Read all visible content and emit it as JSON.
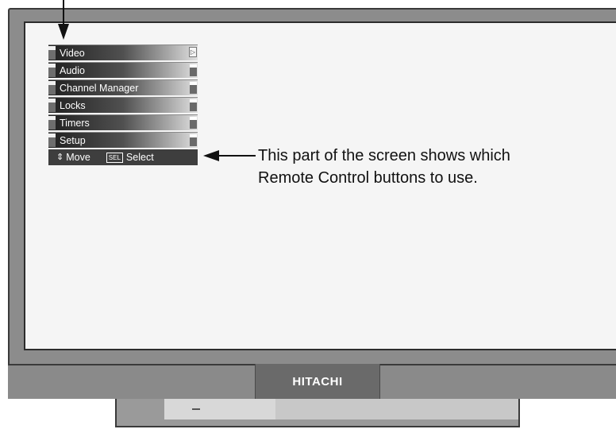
{
  "menu": {
    "items": [
      {
        "label": "Video",
        "icon": "right-arrow-icon"
      },
      {
        "label": "Audio",
        "icon": "menu-tab-icon"
      },
      {
        "label": "Channel Manager",
        "icon": "menu-tab-icon"
      },
      {
        "label": "Locks",
        "icon": "menu-tab-icon"
      },
      {
        "label": "Timers",
        "icon": "menu-tab-icon"
      },
      {
        "label": "Setup",
        "icon": "menu-tab-icon"
      }
    ],
    "help": {
      "move_icon": "up-down-arrows-icon",
      "move_label": "Move",
      "select_key": "SEL",
      "select_label": "Select"
    }
  },
  "annotation": {
    "line1": "This part of the screen shows which",
    "line2": "Remote Control buttons to use."
  },
  "brand": "HITACHI",
  "colors": {
    "bezel": "#8c8c8c",
    "screen": "#f5f5f5",
    "brand_panel": "#6a6a6a",
    "menu_bar_dark": "#202020",
    "menu_bar_light": "#e0e0e0"
  }
}
